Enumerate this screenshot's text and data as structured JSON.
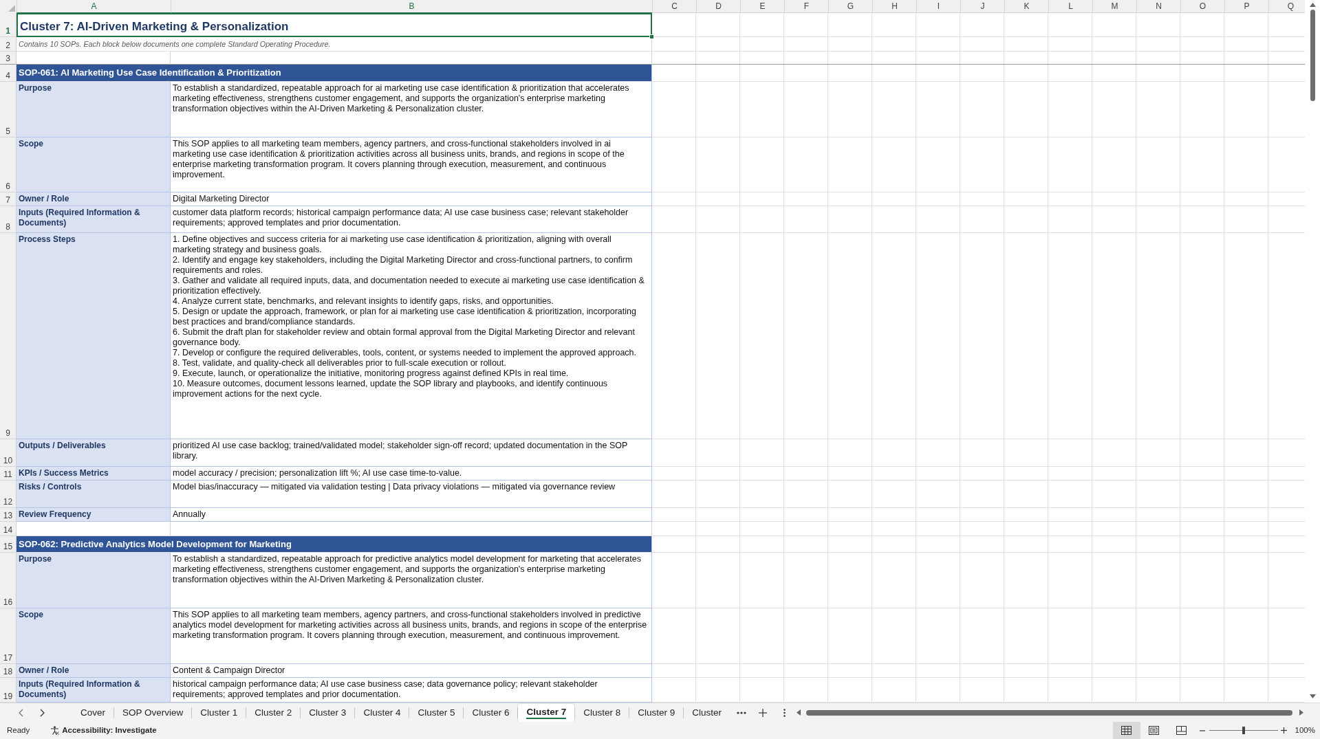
{
  "sheet": {
    "columns": [
      {
        "label": "A",
        "selected": true
      },
      {
        "label": "B",
        "selected": true
      },
      {
        "label": "C",
        "selected": false
      },
      {
        "label": "D",
        "selected": false
      },
      {
        "label": "E",
        "selected": false
      },
      {
        "label": "F",
        "selected": false
      },
      {
        "label": "G",
        "selected": false
      },
      {
        "label": "H",
        "selected": false
      },
      {
        "label": "I",
        "selected": false
      },
      {
        "label": "J",
        "selected": false
      },
      {
        "label": "K",
        "selected": false
      },
      {
        "label": "L",
        "selected": false
      },
      {
        "label": "M",
        "selected": false
      },
      {
        "label": "N",
        "selected": false
      },
      {
        "label": "O",
        "selected": false
      },
      {
        "label": "P",
        "selected": false
      },
      {
        "label": "Q",
        "selected": false
      }
    ],
    "rows": [
      {
        "number": "1",
        "selected": true,
        "kind": "title",
        "text": "Cluster 7: AI-Driven Marketing & Personalization"
      },
      {
        "number": "2",
        "selected": false,
        "kind": "note",
        "text": "Contains 10 SOPs. Each block below documents one complete Standard Operating Procedure."
      },
      {
        "number": "3",
        "selected": false,
        "kind": "blank"
      },
      {
        "number": "4",
        "selected": false,
        "kind": "section",
        "text": "SOP-061: AI Marketing Use Case Identification & Prioritization"
      },
      {
        "number": "5",
        "selected": false,
        "kind": "field",
        "label": "Purpose",
        "value": "To establish a standardized, repeatable approach for ai marketing use case identification & prioritization that accelerates marketing effectiveness, strengthens customer engagement, and supports the organization's enterprise marketing transformation objectives within the AI-Driven Marketing & Personalization cluster."
      },
      {
        "number": "6",
        "selected": false,
        "kind": "field",
        "label": "Scope",
        "value": "This SOP applies to all marketing team members, agency partners, and cross-functional stakeholders involved in ai marketing use case identification & prioritization activities across all business units, brands, and regions in scope of the enterprise marketing transformation program. It covers planning through execution, measurement, and continuous improvement."
      },
      {
        "number": "7",
        "selected": false,
        "kind": "field",
        "label": "Owner / Role",
        "value": "Digital Marketing Director"
      },
      {
        "number": "8",
        "selected": false,
        "kind": "field",
        "label": "Inputs (Required Information & Documents)",
        "value": "customer data platform records; historical campaign performance data; AI use case business case; relevant stakeholder requirements; approved templates and prior documentation."
      },
      {
        "number": "9",
        "selected": false,
        "kind": "steps",
        "label": "Process Steps",
        "steps": [
          "1. Define objectives and success criteria for ai marketing use case identification & prioritization, aligning with overall marketing strategy and business goals.",
          "2. Identify and engage key stakeholders, including the Digital Marketing Director and cross-functional partners, to confirm requirements and roles.",
          "3. Gather and validate all required inputs, data, and documentation needed to execute ai marketing use case identification & prioritization effectively.",
          "4. Analyze current state, benchmarks, and relevant insights to identify gaps, risks, and opportunities.",
          "5. Design or update the approach, framework, or plan for ai marketing use case identification & prioritization, incorporating best practices and brand/compliance standards.",
          "6. Submit the draft plan for stakeholder review and obtain formal approval from the Digital Marketing Director and relevant governance body.",
          "7. Develop or configure the required deliverables, tools, content, or systems needed to implement the approved approach.",
          "8. Test, validate, and quality-check all deliverables prior to full-scale execution or rollout.",
          "9. Execute, launch, or operationalize the initiative, monitoring progress against defined KPIs in real time.",
          "10. Measure outcomes, document lessons learned, update the SOP library and playbooks, and identify continuous improvement actions for the next cycle."
        ]
      },
      {
        "number": "10",
        "selected": false,
        "kind": "field",
        "label": "Outputs / Deliverables",
        "value": "prioritized AI use case backlog; trained/validated model; stakeholder sign-off record; updated documentation in the SOP library."
      },
      {
        "number": "11",
        "selected": false,
        "kind": "field",
        "label": "KPIs / Success Metrics",
        "value": "model accuracy / precision; personalization lift %; AI use case time-to-value."
      },
      {
        "number": "12",
        "selected": false,
        "kind": "field",
        "label": "Risks / Controls",
        "value": "Model bias/inaccuracy — mitigated via validation testing | Data privacy violations — mitigated via governance review"
      },
      {
        "number": "13",
        "selected": false,
        "kind": "field",
        "label": "Review Frequency",
        "value": "Annually"
      },
      {
        "number": "14",
        "selected": false,
        "kind": "blank"
      },
      {
        "number": "15",
        "selected": false,
        "kind": "section",
        "text": "SOP-062: Predictive Analytics Model Development for Marketing"
      },
      {
        "number": "16",
        "selected": false,
        "kind": "field",
        "label": "Purpose",
        "value": "To establish a standardized, repeatable approach for predictive analytics model development for marketing that accelerates marketing effectiveness, strengthens customer engagement, and supports the organization's enterprise marketing transformation objectives within the AI-Driven Marketing & Personalization cluster."
      },
      {
        "number": "17",
        "selected": false,
        "kind": "field",
        "label": "Scope",
        "value": "This SOP applies to all marketing team members, agency partners, and cross-functional stakeholders involved in predictive analytics model development for marketing activities across all business units, brands, and regions in scope of the enterprise marketing transformation program. It covers planning through execution, measurement, and continuous improvement."
      },
      {
        "number": "18",
        "selected": false,
        "kind": "field",
        "label": "Owner / Role",
        "value": "Content & Campaign Director"
      },
      {
        "number": "19",
        "selected": false,
        "kind": "field",
        "label": "Inputs (Required Information & Documents)",
        "value": "historical campaign performance data; AI use case business case; data governance policy; relevant stakeholder requirements; approved templates and prior documentation."
      }
    ]
  },
  "sheet_tabs": [
    {
      "label": "Cover",
      "selected": false
    },
    {
      "label": "SOP Overview",
      "selected": false
    },
    {
      "label": "Cluster 1",
      "selected": false
    },
    {
      "label": "Cluster 2",
      "selected": false
    },
    {
      "label": "Cluster 3",
      "selected": false
    },
    {
      "label": "Cluster 4",
      "selected": false
    },
    {
      "label": "Cluster 5",
      "selected": false
    },
    {
      "label": "Cluster 6",
      "selected": false
    },
    {
      "label": "Cluster 7",
      "selected": true
    },
    {
      "label": "Cluster 8",
      "selected": false
    },
    {
      "label": "Cluster 9",
      "selected": false
    },
    {
      "label": "Cluster",
      "selected": false
    }
  ],
  "status_bar": {
    "status": "Ready",
    "accessibility": "Accessibility: Investigate",
    "views": [
      {
        "kind": "normal",
        "selected": true
      },
      {
        "kind": "page_layout",
        "selected": false
      },
      {
        "kind": "page_break_preview",
        "selected": false
      }
    ],
    "zoom": {
      "level": 0.5,
      "reading": "100%"
    }
  }
}
